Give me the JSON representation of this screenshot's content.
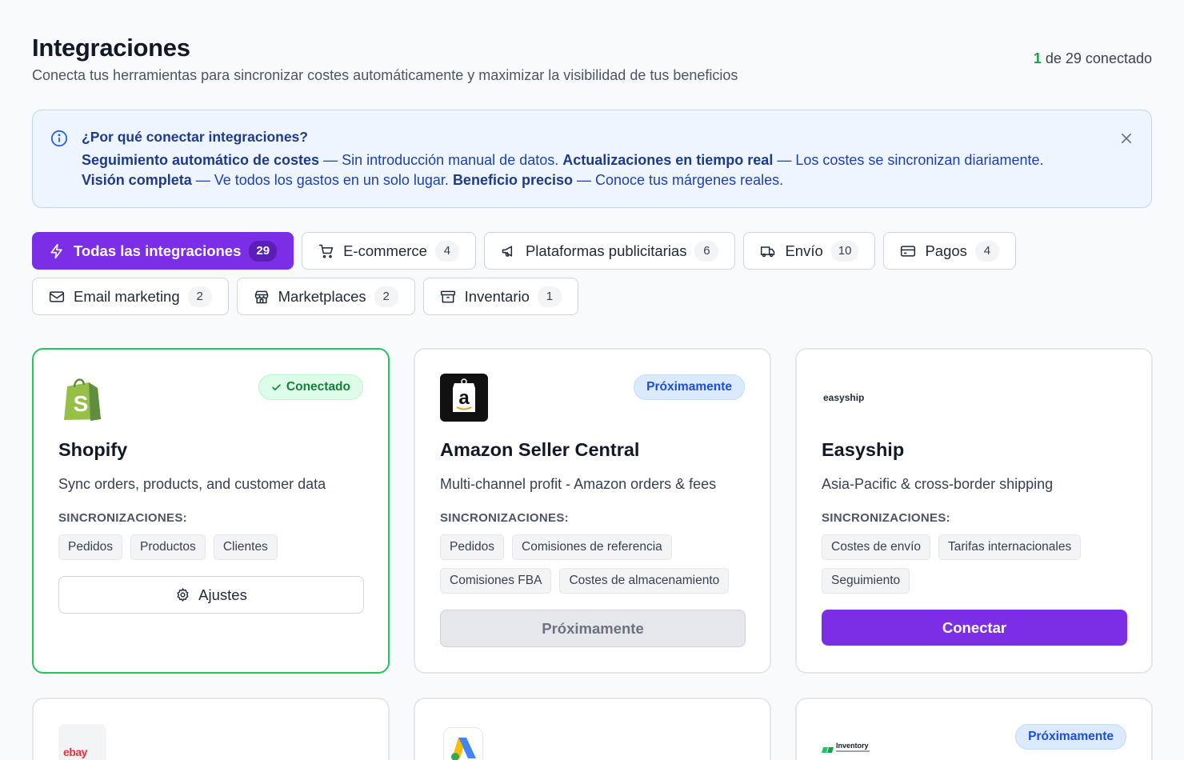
{
  "header": {
    "title": "Integraciones",
    "subtitle": "Conecta tus herramientas para sincronizar costes automáticamente y maximizar la visibilidad de tus beneficios",
    "connected_num": "1",
    "connected_rest": " de 29 conectado"
  },
  "banner": {
    "title": "¿Por qué conectar integraciones?",
    "b1_strong": "Seguimiento automático de costes",
    "b1_text": " — Sin introducción manual de datos. ",
    "b2_strong": "Actualizaciones en tiempo real",
    "b2_text": " — Los costes se sincronizan diariamente.",
    "b3_strong": "Visión completa",
    "b3_text": " — Ve todos los gastos en un solo lugar. ",
    "b4_strong": "Beneficio preciso",
    "b4_text": " — Conoce tus márgenes reales."
  },
  "filters": [
    {
      "label": "Todas las integraciones",
      "count": "29",
      "icon": "lightning-icon"
    },
    {
      "label": "E-commerce",
      "count": "4",
      "icon": "cart-icon"
    },
    {
      "label": "Plataformas publicitarias",
      "count": "6",
      "icon": "megaphone-icon"
    },
    {
      "label": "Envío",
      "count": "10",
      "icon": "truck-icon"
    },
    {
      "label": "Pagos",
      "count": "4",
      "icon": "credit-card-icon"
    },
    {
      "label": "Email marketing",
      "count": "2",
      "icon": "mail-icon"
    },
    {
      "label": "Marketplaces",
      "count": "2",
      "icon": "store-icon"
    },
    {
      "label": "Inventario",
      "count": "1",
      "icon": "archive-icon"
    }
  ],
  "syncs_label": "SINCRONIZACIONES:",
  "cards": [
    {
      "name": "Shopify",
      "desc": "Sync orders, products, and customer data",
      "status": "Conectado",
      "tags": [
        "Pedidos",
        "Productos",
        "Clientes"
      ],
      "action": "Ajustes"
    },
    {
      "name": "Amazon Seller Central",
      "desc": "Multi-channel profit - Amazon orders & fees",
      "status": "Próximamente",
      "tags": [
        "Pedidos",
        "Comisiones de referencia",
        "Comisiones FBA",
        "Costes de almacenamiento"
      ],
      "action": "Próximamente"
    },
    {
      "name": "Easyship",
      "logo_text": "easyship",
      "desc": "Asia-Pacific & cross-border shipping",
      "tags": [
        "Costes de envío",
        "Tarifas internacionales",
        "Seguimiento"
      ],
      "action": "Conectar"
    }
  ],
  "row2": {
    "ebay_logo_text": "ebay",
    "inventory_logo_text": "Inventory",
    "inventory_badge": "Próximamente"
  },
  "colors": {
    "accent": "#7c2ee6",
    "connected": "#22c55e",
    "info_bg": "#eef5fe"
  }
}
